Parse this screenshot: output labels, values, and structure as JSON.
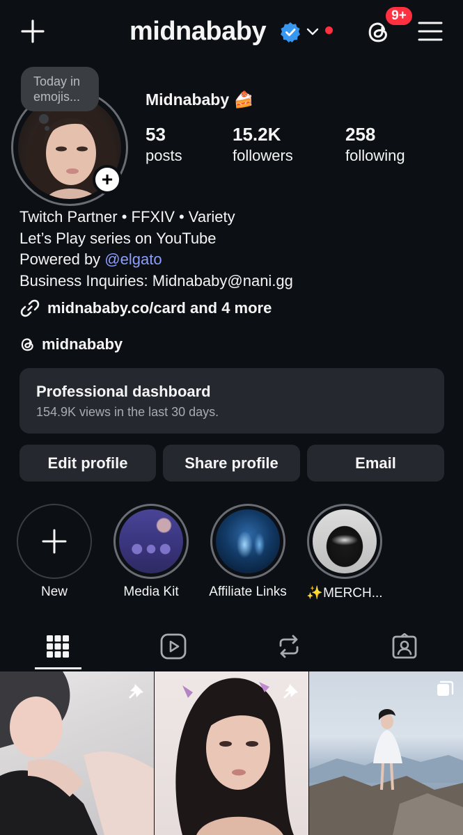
{
  "header": {
    "username": "midnababy",
    "notification_badge": "9+"
  },
  "profile": {
    "note": "Today in emojis...",
    "display_name": "Midnababy 🍰",
    "stats": [
      {
        "value": "53",
        "label": "posts"
      },
      {
        "value": "15.2K",
        "label": "followers"
      },
      {
        "value": "258",
        "label": "following"
      }
    ],
    "bio_lines": [
      "Twitch Partner • FFXIV • Variety",
      "Let’s Play series on YouTube"
    ],
    "bio_powered_prefix": "Powered by ",
    "bio_powered_mention": "@elgato",
    "bio_business": "Business Inquiries: Midnababy@nani.gg",
    "link_text": "midnababy.co/card and 4 more",
    "threads_handle": "midnababy"
  },
  "dashboard": {
    "title": "Professional dashboard",
    "subtitle": "154.9K views in the last 30 days."
  },
  "actions": {
    "edit": "Edit profile",
    "share": "Share profile",
    "email": "Email"
  },
  "highlights": [
    {
      "label": "New"
    },
    {
      "label": "Media Kit"
    },
    {
      "label": "Affiliate Links"
    },
    {
      "label": "✨MERCH..."
    }
  ],
  "tabs": [
    "grid-icon",
    "reels-icon",
    "reposts-icon",
    "tagged-icon"
  ],
  "colors": {
    "background": "#0c0f14",
    "card": "#25282e",
    "badge": "#ff3040",
    "verified": "#3897f0",
    "mention": "#8c9eff"
  }
}
